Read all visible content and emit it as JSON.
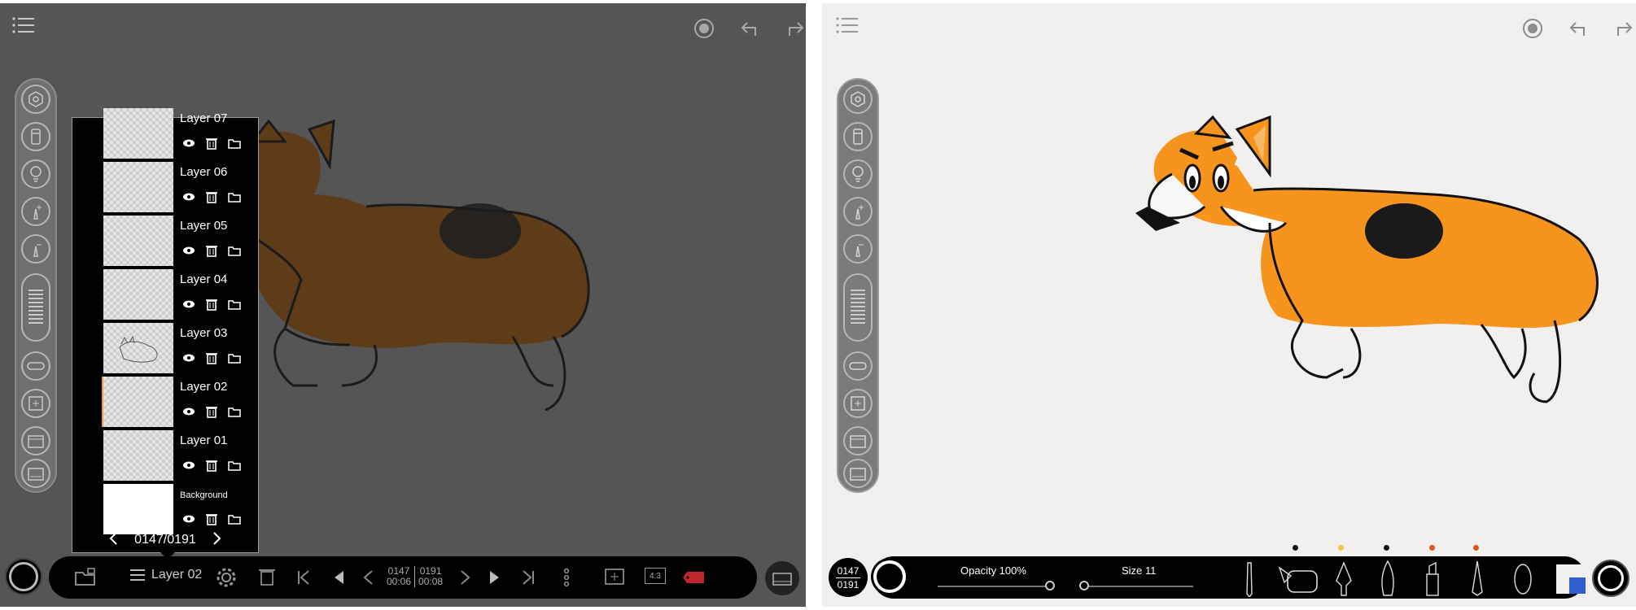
{
  "left_panel": {
    "layers": [
      {
        "name": "Layer 07"
      },
      {
        "name": "Layer 06"
      },
      {
        "name": "Layer 05"
      },
      {
        "name": "Layer 04"
      },
      {
        "name": "Layer 03"
      },
      {
        "name": "Layer 02",
        "selected": true
      },
      {
        "name": "Layer 01"
      },
      {
        "name": "Background"
      }
    ],
    "popup_frame": "0147/0191",
    "bottom_bar": {
      "layer_label": "Layer 02",
      "frame_current": "0147",
      "time_current": "00:06",
      "frame_total": "0191",
      "time_total": "00:08",
      "aspect_label": "4:3"
    }
  },
  "right_panel": {
    "frame_current": "0147",
    "frame_total": "0191",
    "opacity_label": "Opacity 100%",
    "size_label": "Size 11",
    "opacity_value": 1.0,
    "size_value": 11,
    "brush_dot_colors": [
      "#111111",
      "#f5c542",
      "#111111",
      "#d9541e",
      "#d9541e"
    ]
  },
  "colors": {
    "corgi_orange": "#f7941d",
    "corgi_orange_dimmed": "#8a4e0a",
    "selected_layer": "#f0a030",
    "accent_blue": "#2f5fcf"
  },
  "icons": [
    "menu-icon",
    "record-icon",
    "undo-icon",
    "redo-icon",
    "settings-icon",
    "trash-icon",
    "eye-icon",
    "folder-icon"
  ]
}
